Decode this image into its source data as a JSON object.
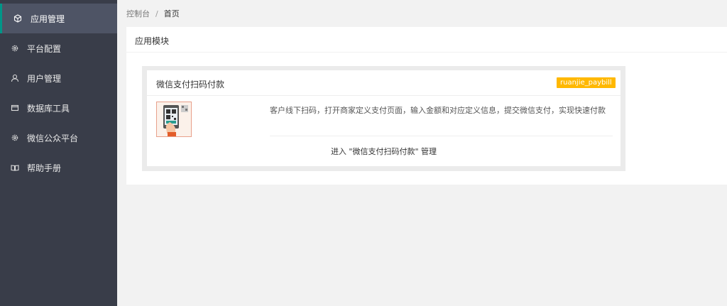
{
  "sidebar": {
    "items": [
      {
        "label": "应用管理",
        "icon": "cube-icon"
      },
      {
        "label": "平台配置",
        "icon": "gear-icon"
      },
      {
        "label": "用户管理",
        "icon": "user-icon"
      },
      {
        "label": "数据库工具",
        "icon": "database-icon"
      },
      {
        "label": "微信公众平台",
        "icon": "gear-icon"
      },
      {
        "label": "帮助手册",
        "icon": "book-icon"
      }
    ],
    "active_index": 0
  },
  "breadcrumb": {
    "items": [
      "控制台",
      "首页"
    ],
    "separator": "/"
  },
  "panel": {
    "title": "应用模块"
  },
  "module_card": {
    "title": "微信支付扫码付款",
    "badge": "ruanjie_paybill",
    "thumbnail": "qr-phone-scan-image",
    "description": "客户线下扫码，打开商家定义支付页面，输入金额和对应定义信息，提交微信支付，实现快速付款",
    "link_text": "进入 \"微信支付扫码付款\" 管理"
  },
  "colors": {
    "sidebar_bg": "#393d49",
    "sidebar_active_bg": "#4e5465",
    "active_accent": "#009688",
    "badge_bg": "#ffb800",
    "page_bg": "#f2f2f2"
  }
}
